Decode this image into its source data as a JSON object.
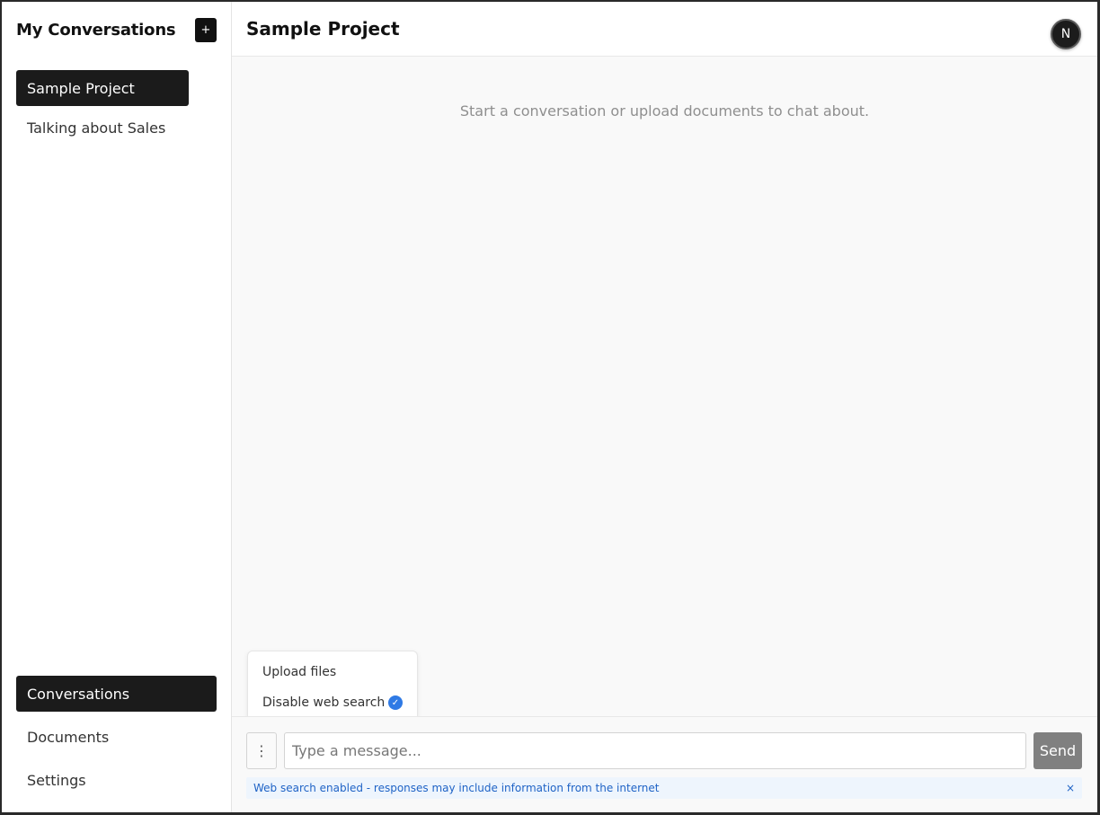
{
  "sidebar": {
    "title": "My Conversations",
    "new_button": "+",
    "conversations": [
      {
        "label": "Sample Project"
      },
      {
        "label": "Talking about Sales"
      }
    ],
    "nav": [
      {
        "label": "Conversations"
      },
      {
        "label": "Documents"
      },
      {
        "label": "Settings"
      }
    ]
  },
  "main": {
    "title": "Sample Project",
    "avatar": "N",
    "empty_message": "Start a conversation or upload documents to chat about."
  },
  "menu": {
    "items": [
      {
        "label": "Upload files"
      },
      {
        "label": "Disable web search",
        "icon": "check-icon",
        "checked": true
      }
    ],
    "check_glyph": "✓"
  },
  "composer": {
    "more_glyph": "⋮",
    "placeholder": "Type a message...",
    "send_label": "Send",
    "notice": "Web search enabled - responses may include information from the internet",
    "notice_close": "×"
  },
  "colors": {
    "accent": "#2f7ae5",
    "active_bg": "#1b1b1b",
    "notice_bg": "#eef5fd",
    "notice_text": "#1f63c6"
  }
}
